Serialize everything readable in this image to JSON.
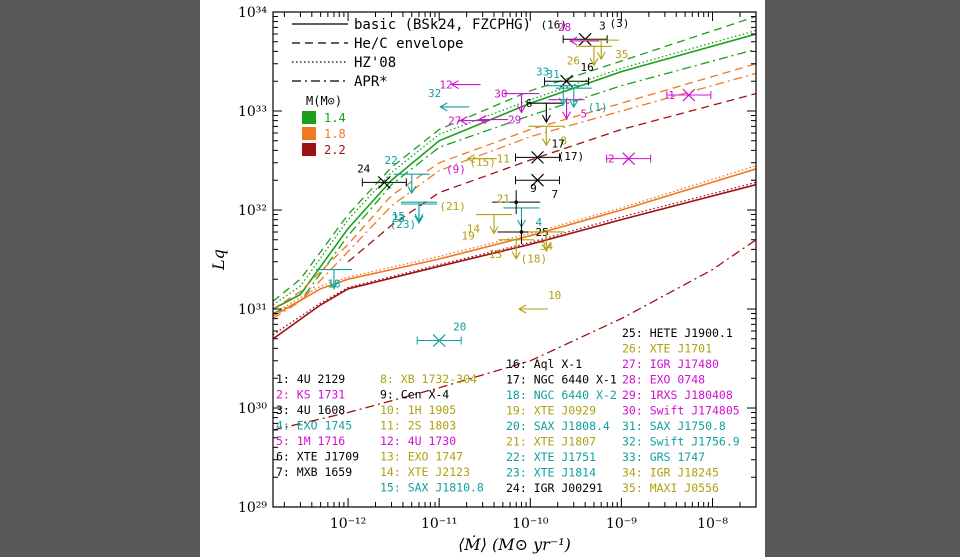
{
  "chart_data": {
    "type": "line",
    "xlabel": "⟨Ṁ⟩ (M⊙ yr⁻¹)",
    "ylabel": "Lq",
    "xscale": "log",
    "yscale": "log",
    "xlim": [
      1.5e-13,
      3e-08
    ],
    "ylim": [
      1e+29,
      1e+34
    ],
    "x_ticks": [
      {
        "v": 1e-12,
        "label": "10⁻¹²"
      },
      {
        "v": 1e-11,
        "label": "10⁻¹¹"
      },
      {
        "v": 1e-10,
        "label": "10⁻¹⁰"
      },
      {
        "v": 1e-09,
        "label": "10⁻⁹"
      },
      {
        "v": 1e-08,
        "label": "10⁻⁸"
      }
    ],
    "y_ticks": [
      {
        "v": 1e+29,
        "label": "10²⁹"
      },
      {
        "v": 1e+30,
        "label": "10³⁰"
      },
      {
        "v": 1e+31,
        "label": "10³¹"
      },
      {
        "v": 1e+32,
        "label": "10³²"
      },
      {
        "v": 1e+33,
        "label": "10³³"
      },
      {
        "v": 1e+34,
        "label": "10³⁴"
      }
    ],
    "line_styles": [
      {
        "key": "basic",
        "label": "basic (BSk24, FZCPHG)",
        "dash": ""
      },
      {
        "key": "hec",
        "label": "He/C envelope",
        "dash": "8,5"
      },
      {
        "key": "hz",
        "label": "HZ'08",
        "dash": "1.5,2.5"
      },
      {
        "key": "apr",
        "label": "APR*",
        "dash": "9,4,2,4"
      }
    ],
    "mass_legend": {
      "title": "M(M⊙)",
      "entries": [
        {
          "mass": "1.4",
          "color": "#1aa01a"
        },
        {
          "mass": "1.8",
          "color": "#f07820"
        },
        {
          "mass": "2.2",
          "color": "#a01010"
        }
      ]
    },
    "series": [
      {
        "mass": "1.4",
        "style": "basic",
        "color": "#1aa01a",
        "points": [
          [
            1.5e-13,
            1e+31
          ],
          [
            3e-13,
            1.4e+31
          ],
          [
            1e-12,
            6.5e+31
          ],
          [
            3e-12,
            2e+32
          ],
          [
            1e-11,
            5e+32
          ],
          [
            1e-10,
            1.2e+33
          ],
          [
            1e-09,
            2.5e+33
          ],
          [
            3e-08,
            6e+33
          ]
        ]
      },
      {
        "mass": "1.4",
        "style": "hec",
        "color": "#1aa01a",
        "points": [
          [
            1.5e-13,
            1.2e+31
          ],
          [
            3e-13,
            2e+31
          ],
          [
            1e-12,
            9e+31
          ],
          [
            3e-12,
            2.7e+32
          ],
          [
            1e-11,
            6.5e+32
          ],
          [
            1e-10,
            1.6e+33
          ],
          [
            1e-09,
            3.2e+33
          ],
          [
            3e-08,
            9e+33
          ]
        ]
      },
      {
        "mass": "1.4",
        "style": "hz",
        "color": "#1aa01a",
        "points": [
          [
            1.5e-13,
            1.1e+31
          ],
          [
            3e-13,
            1.7e+31
          ],
          [
            1e-12,
            8e+31
          ],
          [
            3e-12,
            2.4e+32
          ],
          [
            1e-11,
            5.8e+32
          ],
          [
            1e-10,
            1.3e+33
          ],
          [
            1e-09,
            2.7e+33
          ],
          [
            3e-08,
            6.5e+33
          ]
        ]
      },
      {
        "mass": "1.4",
        "style": "apr",
        "color": "#1aa01a",
        "points": [
          [
            1.5e-13,
            9e+30
          ],
          [
            3e-13,
            1.2e+31
          ],
          [
            1e-12,
            5.5e+31
          ],
          [
            3e-12,
            1.8e+32
          ],
          [
            1e-11,
            4.3e+32
          ],
          [
            1e-10,
            9e+32
          ],
          [
            1e-09,
            1.8e+33
          ],
          [
            3e-08,
            4.2e+33
          ]
        ]
      },
      {
        "mass": "1.8",
        "style": "basic",
        "color": "#f07820",
        "points": [
          [
            1.5e-13,
            8.5e+30
          ],
          [
            5e-13,
            1.6e+31
          ],
          [
            1e-12,
            2e+31
          ],
          [
            1e-11,
            3.2e+31
          ],
          [
            1e-10,
            5.5e+31
          ],
          [
            1e-09,
            1e+32
          ],
          [
            3e-08,
            2.6e+32
          ]
        ]
      },
      {
        "mass": "1.8",
        "style": "hec",
        "color": "#f07820",
        "points": [
          [
            1.5e-13,
            1e+31
          ],
          [
            3e-13,
            1.5e+31
          ],
          [
            1e-12,
            4.5e+31
          ],
          [
            3e-12,
            1.4e+32
          ],
          [
            1e-11,
            3e+32
          ],
          [
            1e-10,
            6.5e+32
          ],
          [
            1e-09,
            1.2e+33
          ],
          [
            3e-08,
            3e+33
          ]
        ]
      },
      {
        "mass": "1.8",
        "style": "hz",
        "color": "#f07820",
        "points": [
          [
            1.5e-13,
            9e+30
          ],
          [
            5e-13,
            1.7e+31
          ],
          [
            1e-12,
            2.1e+31
          ],
          [
            1e-11,
            3.4e+31
          ],
          [
            1e-10,
            5.8e+31
          ],
          [
            1e-09,
            1.05e+32
          ],
          [
            3e-08,
            2.8e+32
          ]
        ]
      },
      {
        "mass": "1.8",
        "style": "apr",
        "color": "#f07820",
        "points": [
          [
            1.5e-13,
            8e+30
          ],
          [
            3e-13,
            1.2e+31
          ],
          [
            1e-12,
            3.8e+31
          ],
          [
            3e-12,
            1.1e+32
          ],
          [
            1e-11,
            2.5e+32
          ],
          [
            1e-10,
            5.5e+32
          ],
          [
            1e-09,
            1e+33
          ],
          [
            3e-08,
            2.4e+33
          ]
        ]
      },
      {
        "mass": "2.2",
        "style": "basic",
        "color": "#a01010",
        "points": [
          [
            1.5e-13,
            5e+30
          ],
          [
            5e-13,
            1.1e+31
          ],
          [
            1e-12,
            1.6e+31
          ],
          [
            1e-11,
            2.7e+31
          ],
          [
            1e-10,
            4.5e+31
          ],
          [
            1e-09,
            8e+31
          ],
          [
            3e-08,
            1.8e+32
          ]
        ]
      },
      {
        "mass": "2.2",
        "style": "hec",
        "color": "#a01010",
        "points": [
          [
            1e-12,
            3e+31
          ],
          [
            3e-12,
            7e+31
          ],
          [
            1e-11,
            1.5e+32
          ],
          [
            1e-10,
            3.2e+32
          ],
          [
            1e-09,
            6.5e+32
          ],
          [
            3e-08,
            1.5e+33
          ]
        ]
      },
      {
        "mass": "2.2",
        "style": "hz",
        "color": "#a01010",
        "points": [
          [
            1.5e-13,
            5.5e+30
          ],
          [
            5e-13,
            1.15e+31
          ],
          [
            1e-12,
            1.65e+31
          ],
          [
            1e-11,
            2.8e+31
          ],
          [
            1e-10,
            4.7e+31
          ],
          [
            1e-09,
            8.5e+31
          ],
          [
            3e-08,
            1.9e+32
          ]
        ]
      },
      {
        "mass": "2.2",
        "style": "apr",
        "color": "#a01010",
        "points": [
          [
            1.5e-13,
            6e+29
          ],
          [
            1e-12,
            9e+29
          ],
          [
            1e-11,
            1.6e+30
          ],
          [
            1e-10,
            3e+30
          ],
          [
            1e-09,
            8e+30
          ],
          [
            1e-08,
            2.5e+31
          ],
          [
            3e-08,
            5e+31
          ]
        ]
      }
    ],
    "sources": [
      {
        "n": 1,
        "name": "4U 2129",
        "color": "#000000"
      },
      {
        "n": 2,
        "name": "KS 1731",
        "color": "#d010d0"
      },
      {
        "n": 3,
        "name": "4U 1608",
        "color": "#000000"
      },
      {
        "n": 4,
        "name": "EXO 1745",
        "color": "#10a0a0"
      },
      {
        "n": 5,
        "name": "1M 1716",
        "color": "#d010d0"
      },
      {
        "n": 6,
        "name": "XTE J1709",
        "color": "#000000"
      },
      {
        "n": 7,
        "name": "MXB 1659",
        "color": "#000000"
      },
      {
        "n": 8,
        "name": "XB 1732-304",
        "color": "#b0a010"
      },
      {
        "n": 9,
        "name": "Cen X-4",
        "color": "#000000"
      },
      {
        "n": 10,
        "name": "1H 1905",
        "color": "#b0a010"
      },
      {
        "n": 11,
        "name": "2S 1803",
        "color": "#b0a010"
      },
      {
        "n": 12,
        "name": "4U 1730",
        "color": "#d010d0"
      },
      {
        "n": 13,
        "name": "EXO 1747",
        "color": "#b0a010"
      },
      {
        "n": 14,
        "name": "XTE J2123",
        "color": "#b0a010"
      },
      {
        "n": 15,
        "name": "SAX J1810.8",
        "color": "#10a0a0"
      },
      {
        "n": 16,
        "name": "Aql X-1",
        "color": "#000000"
      },
      {
        "n": 17,
        "name": "NGC 6440 X-1",
        "color": "#000000"
      },
      {
        "n": 18,
        "name": "NGC 6440 X-2",
        "color": "#10a0a0"
      },
      {
        "n": 19,
        "name": "XTE J0929",
        "color": "#b0a010"
      },
      {
        "n": 20,
        "name": "SAX J1808.4",
        "color": "#10a0a0"
      },
      {
        "n": 21,
        "name": "XTE J1807",
        "color": "#b0a010"
      },
      {
        "n": 22,
        "name": "XTE J1751",
        "color": "#10a0a0"
      },
      {
        "n": 23,
        "name": "XTE J1814",
        "color": "#10a0a0"
      },
      {
        "n": 24,
        "name": "IGR J00291",
        "color": "#000000"
      },
      {
        "n": 25,
        "name": "HETE J1900.1",
        "color": "#000000"
      },
      {
        "n": 26,
        "name": "XTE J1701",
        "color": "#b0a010"
      },
      {
        "n": 27,
        "name": "IGR J17480",
        "color": "#d010d0"
      },
      {
        "n": 28,
        "name": "EXO 0748",
        "color": "#d010d0"
      },
      {
        "n": 29,
        "name": "1RXS J180408",
        "color": "#d010d0"
      },
      {
        "n": 30,
        "name": "Swift J174805",
        "color": "#d010d0"
      },
      {
        "n": 31,
        "name": "SAX J1750.8",
        "color": "#10a0a0"
      },
      {
        "n": 32,
        "name": "Swift J1756.9",
        "color": "#10a0a0"
      },
      {
        "n": 33,
        "name": "GRS 1747",
        "color": "#10a0a0"
      },
      {
        "n": 34,
        "name": "IGR J18245",
        "color": "#b0a010"
      },
      {
        "n": 35,
        "name": "MAXI J0556",
        "color": "#b0a010"
      }
    ],
    "points": [
      {
        "label": "1",
        "x": 5.5e-09,
        "y": 1.45e+33,
        "marker": "x",
        "color": "#d010d0",
        "lx": -1,
        "ly": 0
      },
      {
        "label": "2",
        "x": 1.2e-09,
        "y": 3.3e+32,
        "marker": "x",
        "color": "#d010d0",
        "lx": -1,
        "ly": 0
      },
      {
        "label": "3",
        "x": 4e-10,
        "y": 5.3e+33,
        "marker": "x",
        "color": "#000000",
        "lx": 1,
        "ly": -1
      },
      {
        "label": "4",
        "x": 8e-11,
        "y": 1.05e+32,
        "marker": "arrow",
        "color": "#10a0a0",
        "lx": 1,
        "ly": 1
      },
      {
        "label": "5",
        "x": 2.5e-10,
        "y": 1.3e+33,
        "marker": "arrow",
        "color": "#d010d0",
        "lx": 1,
        "ly": 1
      },
      {
        "label": "6",
        "x": 1.5e-10,
        "y": 1.2e+33,
        "marker": "arrow",
        "color": "#000000",
        "lx": -1,
        "ly": 0
      },
      {
        "label": "7",
        "x": 1.2e-10,
        "y": 2e+32,
        "marker": "x",
        "color": "#000000",
        "lx": 1,
        "ly": 1
      },
      {
        "label": "8",
        "x": 1.5e-10,
        "y": 7e+32,
        "marker": "arrow",
        "color": "#b0a010",
        "lx": 1,
        "ly": 1
      },
      {
        "label": "9",
        "x": 7e-11,
        "y": 1.2e+32,
        "marker": "dot",
        "color": "#000000",
        "lx": 1,
        "ly": -1
      },
      {
        "label": "10",
        "x": 1.1e-10,
        "y": 1e+31,
        "marker": "arrowl",
        "color": "#b0a010",
        "lx": 1,
        "ly": -1
      },
      {
        "label": "11",
        "x": 3e-11,
        "y": 3.3e+32,
        "marker": "arrowl",
        "color": "#b0a010",
        "lx": 1,
        "ly": 0
      },
      {
        "label": "12",
        "x": 2e-11,
        "y": 1.85e+33,
        "marker": "arrowl",
        "color": "#d010d0",
        "lx": -1,
        "ly": 0
      },
      {
        "label": "13",
        "x": 7e-11,
        "y": 5e+31,
        "marker": "arrow",
        "color": "#b0a010",
        "lx": -1,
        "ly": 1
      },
      {
        "label": "14",
        "x": 4e-11,
        "y": 9e+31,
        "marker": "arrow",
        "color": "#b0a010",
        "lx": -1,
        "ly": 1
      },
      {
        "label": "15",
        "x": 6e-12,
        "y": 1.2e+32,
        "marker": "arrow",
        "color": "#10a0a0",
        "lx": -1,
        "ly": 1
      },
      {
        "label": "16",
        "x": 2.5e-10,
        "y": 2e+33,
        "marker": "x",
        "color": "#000000",
        "lx": 1,
        "ly": -1
      },
      {
        "label": "17",
        "x": 1.2e-10,
        "y": 3.4e+32,
        "marker": "x",
        "color": "#000000",
        "lx": 1,
        "ly": -1
      },
      {
        "label": "18",
        "x": 7e-13,
        "y": 2.5e+31,
        "marker": "arrow",
        "color": "#10a0a0",
        "lx": 0,
        "ly": 1
      },
      {
        "label": "20",
        "x": 1e-11,
        "y": 4.8e+30,
        "marker": "x",
        "color": "#10a0a0",
        "lx": 1,
        "ly": -1
      },
      {
        "label": "22",
        "x": 5e-12,
        "y": 2.3e+32,
        "marker": "arrow",
        "color": "#10a0a0",
        "lx": -1,
        "ly": -1
      },
      {
        "label": "23",
        "x": 6e-12,
        "y": 1.15e+32,
        "marker": "arrow",
        "color": "#10a0a0",
        "lx": -1,
        "ly": 1
      },
      {
        "label": "24",
        "x": 2.5e-12,
        "y": 1.9e+32,
        "marker": "x",
        "color": "#000000",
        "lx": -1,
        "ly": -1
      },
      {
        "label": "25",
        "x": 8e-11,
        "y": 6e+31,
        "marker": "dot",
        "color": "#000000",
        "lx": 1,
        "ly": 0
      },
      {
        "label": "26",
        "x": 5e-10,
        "y": 4.5e+33,
        "marker": "arrow",
        "color": "#b0a010",
        "lx": -1,
        "ly": 1
      },
      {
        "label": "27",
        "x": 2.5e-11,
        "y": 8e+32,
        "marker": "arrowl",
        "color": "#d010d0",
        "lx": -1,
        "ly": 0
      },
      {
        "label": "28",
        "x": 4e-10,
        "y": 5.1e+33,
        "marker": "arrowl",
        "color": "#d010d0",
        "lx": -1,
        "ly": -1
      },
      {
        "label": "29",
        "x": 4e-11,
        "y": 8.2e+32,
        "marker": "arrowl",
        "color": "#d010d0",
        "lx": 1,
        "ly": 0
      },
      {
        "label": "30",
        "x": 8e-11,
        "y": 1.5e+33,
        "marker": "arrow",
        "color": "#d010d0",
        "lx": -1,
        "ly": 0
      },
      {
        "label": "31",
        "x": 3e-10,
        "y": 1.7e+33,
        "marker": "arrow",
        "color": "#10a0a0",
        "lx": -1,
        "ly": -1
      },
      {
        "label": "32",
        "x": 1.5e-11,
        "y": 1.1e+33,
        "marker": "arrowl",
        "color": "#10a0a0",
        "lx": -1,
        "ly": -1
      },
      {
        "label": "33",
        "x": 2.3e-10,
        "y": 1.8e+33,
        "marker": "arrow",
        "color": "#10a0a0",
        "lx": -1,
        "ly": -1
      },
      {
        "label": "34",
        "x": 1.5e-10,
        "y": 6e+31,
        "marker": "arrow",
        "color": "#b0a010",
        "lx": 0,
        "ly": 1
      },
      {
        "label": "35",
        "x": 6e-10,
        "y": 5.2e+33,
        "marker": "arrow",
        "color": "#b0a010",
        "lx": 1,
        "ly": 1
      },
      {
        "label": "(16)",
        "x": 3.6e-10,
        "y": 5.4e+33,
        "marker": "none",
        "color": "#000000",
        "lx": -1,
        "ly": -1
      },
      {
        "label": "(3)",
        "x": 5.2e-10,
        "y": 5.6e+33,
        "marker": "none",
        "color": "#000000",
        "lx": 1,
        "ly": -1
      },
      {
        "label": "(17)",
        "x": 1.4e-10,
        "y": 3.5e+32,
        "marker": "none",
        "color": "#000000",
        "lx": 1,
        "ly": 0
      },
      {
        "label": "(1)",
        "x": 3e-10,
        "y": 1.1e+33,
        "marker": "none",
        "color": "#10a0a0",
        "lx": 1,
        "ly": 0
      },
      {
        "label": "(9)",
        "x": 2.8e-11,
        "y": 2.6e+32,
        "marker": "none",
        "color": "#d010d0",
        "lx": -1,
        "ly": 0
      },
      {
        "label": "(15)",
        "x": 3e-11,
        "y": 2.2e+32,
        "marker": "none",
        "color": "#b0a010",
        "lx": 0,
        "ly": -1
      },
      {
        "label": "(21)",
        "x": 2.8e-11,
        "y": 1.1e+32,
        "marker": "none",
        "color": "#b0a010",
        "lx": -1,
        "ly": 0
      },
      {
        "label": "(23)",
        "x": 4e-12,
        "y": 1e+32,
        "marker": "none",
        "color": "#10a0a0",
        "lx": 0,
        "ly": 1
      },
      {
        "label": "(18)",
        "x": 5.5e-11,
        "y": 4.5e+31,
        "marker": "none",
        "color": "#b0a010",
        "lx": 1,
        "ly": 1
      },
      {
        "label": "19",
        "x": 3.5e-11,
        "y": 5.5e+31,
        "marker": "none",
        "color": "#b0a010",
        "lx": -1,
        "ly": 0
      },
      {
        "label": "21",
        "x": 3e-11,
        "y": 1.3e+32,
        "marker": "none",
        "color": "#b0a010",
        "lx": 1,
        "ly": 0
      }
    ]
  }
}
